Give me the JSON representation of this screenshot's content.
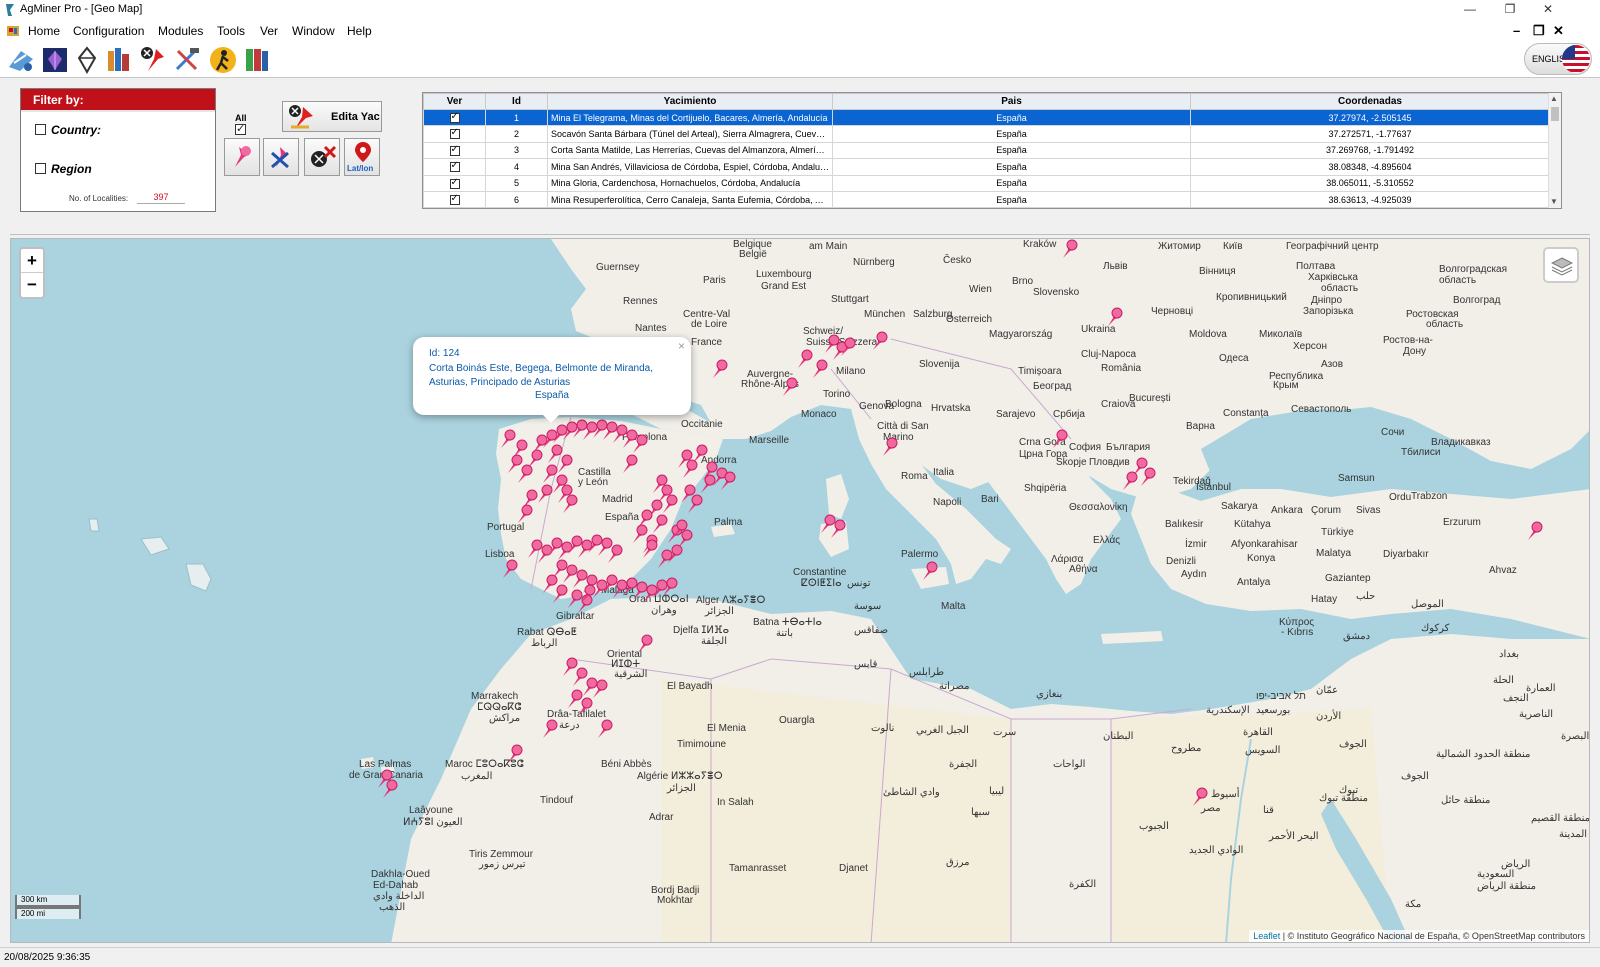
{
  "window": {
    "title": "AgMiner Pro - [Geo Map]"
  },
  "menu": {
    "items": [
      "Home",
      "Configuration",
      "Modules",
      "Tools",
      "Ver",
      "Window",
      "Help"
    ]
  },
  "toolbar": {
    "language": "ENGLISH"
  },
  "filter": {
    "header": "Filter by:",
    "country_label": "Country:",
    "region_label": "Region",
    "localities_label": "No. of Localities:",
    "localities_value": "397"
  },
  "actions": {
    "all_label": "All",
    "edit_label": "Edita Yac",
    "latlon_label": "Lat/lon"
  },
  "table": {
    "columns": [
      "Ver",
      "Id",
      "Yacimiento",
      "Pais",
      "Coordenadas"
    ],
    "rows": [
      {
        "id": "1",
        "name": "Mina El Telegrama, Minas del Cortijuelo, Bacares, Almería, Andalucía",
        "country": "España",
        "coords": "37.27974, -2.505145",
        "selected": true
      },
      {
        "id": "2",
        "name": "Socavón Santa Bárbara (Túnel del Arteal), Sierra Almagrera, Cuevas d...",
        "country": "España",
        "coords": "37.272571, -1.77637",
        "selected": false
      },
      {
        "id": "3",
        "name": "Corta Santa Matilde, Las Herrerías, Cuevas del Almanzora, Almería, A...",
        "country": "España",
        "coords": "37.269768, -1.791492",
        "selected": false
      },
      {
        "id": "4",
        "name": "Mina San Andrés, Villaviciosa de Córdoba, Espiel, Córdoba, Andalucía",
        "country": "España",
        "coords": "38.08348, -4.895604",
        "selected": false
      },
      {
        "id": "5",
        "name": "Mina Gloria, Cardenchosa, Hornachuelos, Córdoba, Andalucía",
        "country": "España",
        "coords": "38.065011, -5.310552",
        "selected": false
      },
      {
        "id": "6",
        "name": "Mina Resuperferolítica, Cerro Canaleja, Santa Eufemia, Córdoba, And...",
        "country": "España",
        "coords": "38.63613, -4.925039",
        "selected": false
      }
    ]
  },
  "map": {
    "popup": {
      "id_line": "Id: 124",
      "name_line": "Corta Boinás Este, Begega, Belmonte de Miranda, Asturias, Principado de Asturias",
      "country_line": "España"
    },
    "zoom_in": "+",
    "zoom_out": "−",
    "scale_km": "300 km",
    "scale_mi": "200 mi",
    "attribution_link": "Leaflet",
    "attribution_text": " | © Instituto Geográfico Nacional de España, © OpenStreetMap contributors"
  },
  "status": {
    "datetime": "20/08/2025 9:36:35"
  },
  "colors": {
    "accent": "#c0111b",
    "selection": "#0a64d2",
    "sea": "#aad3df",
    "land": "#f2efe9",
    "pin": "#e8357a"
  }
}
